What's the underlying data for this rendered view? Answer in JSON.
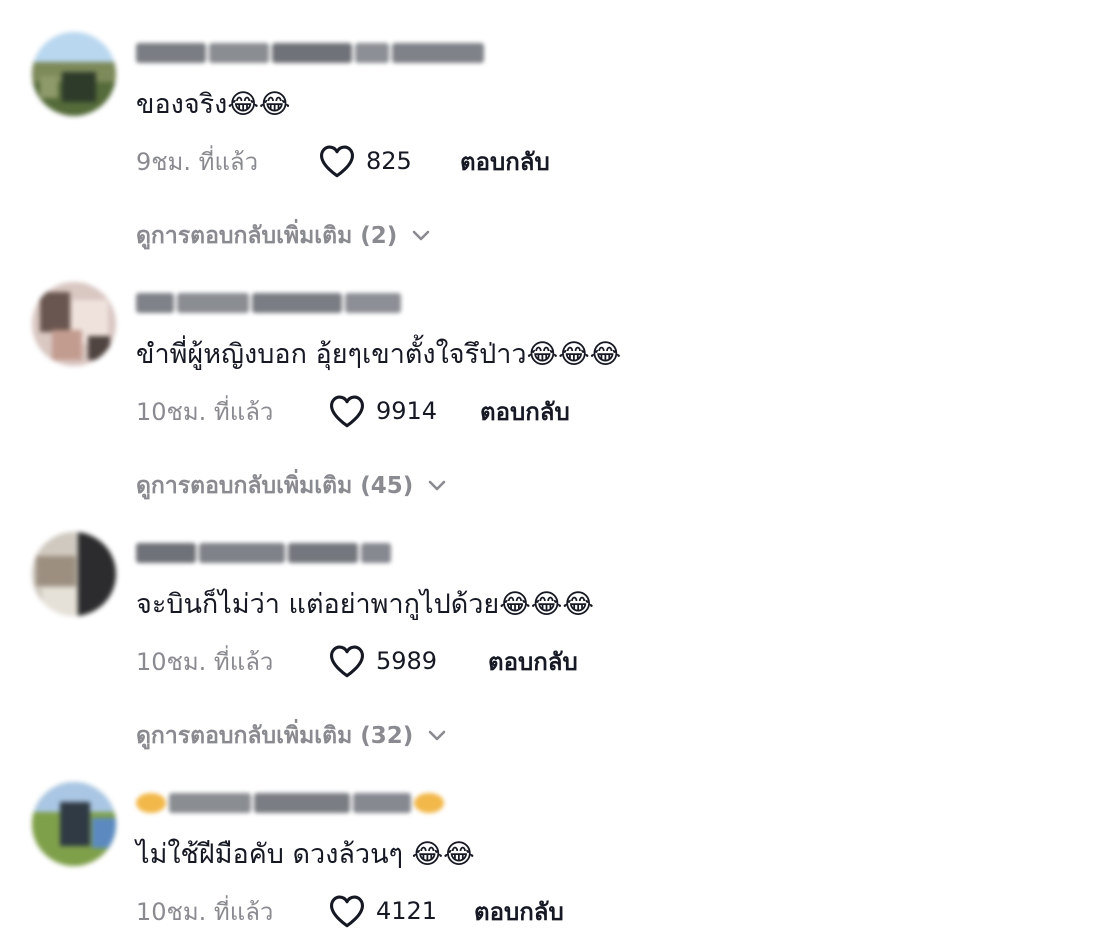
{
  "icons": {
    "like": "heart-outline-icon",
    "expand": "chevron-down-icon"
  },
  "colors": {
    "text": "#161823",
    "secondary": "#8a8b91",
    "background": "#ffffff"
  },
  "comments": [
    {
      "text": "ของจริง😂😂",
      "time": "9ชม. ที่แล้ว",
      "likes": "825",
      "reply_label": "ตอบกลับ",
      "view_more": "ดูการตอบกลับเพิ่มเติม (2)"
    },
    {
      "text": "ขำพี่ผู้หญิงบอก อุ้ยๆเขาตั้งใจรึป่าว😂😂😂",
      "time": "10ชม. ที่แล้ว",
      "likes": "9914",
      "reply_label": "ตอบกลับ",
      "view_more": "ดูการตอบกลับเพิ่มเติม (45)"
    },
    {
      "text": "จะบินก็ไม่ว่า แต่อย่าพากูไปด้วย😂😂😂",
      "time": "10ชม. ที่แล้ว",
      "likes": "5989",
      "reply_label": "ตอบกลับ",
      "view_more": "ดูการตอบกลับเพิ่มเติม (32)"
    },
    {
      "text": "ไม่ใช้ฝีมือคับ ดวงล้วนๆ 😂😂",
      "time": "10ชม. ที่แล้ว",
      "likes": "4121",
      "reply_label": "ตอบกลับ"
    }
  ]
}
